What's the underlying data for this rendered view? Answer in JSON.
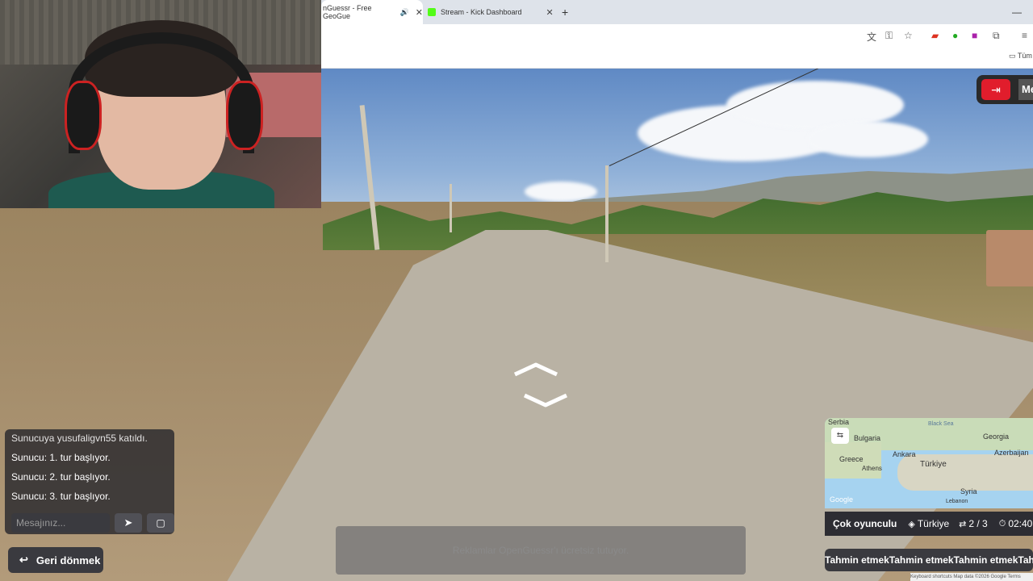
{
  "browser": {
    "tabs": [
      {
        "title": "nGuessr - Free GeoGue",
        "active": true
      },
      {
        "title": "Stream - Kick Dashboard",
        "active": false
      }
    ],
    "new_tab_symbol": "+",
    "bookmark_folder": "Tüm"
  },
  "game": {
    "exit_label": "Me",
    "chat": {
      "messages": [
        "Sunucuya yusufaligvn55 katıldı.",
        "Sunucu: 1. tur başlıyor.",
        "Sunucu: 2. tur başlıyor.",
        "Sunucu: 3. tur başlıyor."
      ],
      "input_placeholder": "Mesajınız..."
    },
    "back_button": "Geri dönmek",
    "ad_text": "Reklamlar OpenGuessr'ı ücretsiz tutuyor.",
    "map": {
      "labels": [
        "Serbia",
        "Bulgaria",
        "Georgia",
        "Greece",
        "Ankara",
        "Türkiye",
        "Azerbaijan",
        "Athens",
        "Syria",
        "Lebanon",
        "Black Sea"
      ],
      "credit": "Google"
    },
    "status": {
      "mode": "Çok oyunculu",
      "region": "Türkiye",
      "round": "2 / 3",
      "timer": "02:40"
    },
    "guess_button": "Tahmin etmekTahmin etmekTahmin etmekTahmin etmekTa",
    "footer": "Keyboard shortcuts  Map data ©2026 Google  Terms"
  }
}
